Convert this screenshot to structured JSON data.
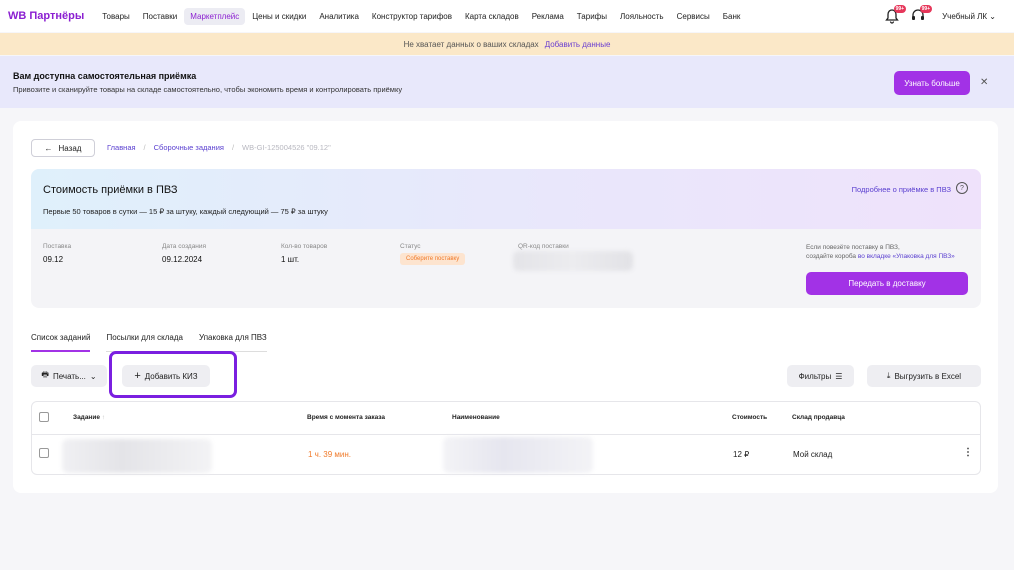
{
  "nav": {
    "logo": "WB Партнёры",
    "items": [
      "Товары",
      "Поставки",
      "Маркетплейс",
      "Цены и скидки",
      "Аналитика",
      "Конструктор тарифов",
      "Карта складов",
      "Реклама",
      "Тарифы",
      "Лояльность",
      "Сервисы",
      "Банк"
    ],
    "active_item": "Маркетплейс",
    "notif_badge_1": "99+",
    "notif_badge_2": "99+",
    "account": "Учебный ЛК"
  },
  "warning": {
    "text": "Не хватает данных о ваших складах",
    "link": "Добавить данные"
  },
  "banner": {
    "title": "Вам доступна самостоятельная приёмка",
    "text": "Привозите и сканируйте товары на складе самостоятельно, чтобы экономить время и контролировать приёмку",
    "button": "Узнать больше"
  },
  "breadcrumb": {
    "back": "Назад",
    "items": [
      "Главная",
      "Сборочные задания"
    ],
    "current": "WB-GI-125004526 \"09.12\""
  },
  "cost": {
    "title": "Стоимость приёмки в ПВЗ",
    "subtitle": "Первые 50 товаров в сутки — 15 ₽ за штуку, каждый следующий — 75 ₽ за штуку",
    "more_link": "Подробнее о приёмке в ПВЗ",
    "fields": [
      {
        "label": "Поставка",
        "value": "09.12"
      },
      {
        "label": "Дата создания",
        "value": "09.12.2024"
      },
      {
        "label": "Кол-во товаров",
        "value": "1 шт."
      },
      {
        "label": "Статус",
        "value": "Соберите поставку"
      },
      {
        "label": "QR-код поставки",
        "value": ""
      }
    ],
    "note_line1": "Если повезёте поставку в ПВЗ,",
    "note_line2_prefix": "создайте короба",
    "note_line2_link": "во вкладке «Упаковка для ПВЗ»",
    "transfer_button": "Передать в доставку"
  },
  "tabs": [
    "Список заданий",
    "Посылки для склада",
    "Упаковка для ПВЗ"
  ],
  "toolbar": {
    "print": "Печать...",
    "add_kiz": "Добавить КИЗ",
    "filters": "Фильтры",
    "excel": "Выгрузить в Excel"
  },
  "table": {
    "headers": [
      "Задание",
      "Время с момента заказа",
      "Наименование",
      "Стоимость",
      "Склад продавца"
    ],
    "row": {
      "time": "1 ч. 39 мин.",
      "price": "12 ₽",
      "warehouse": "Мой склад"
    }
  }
}
